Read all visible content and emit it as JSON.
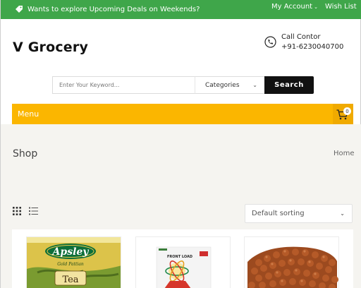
{
  "topbar": {
    "promo_text": "Wants to explore Upcoming Deals on Weekends?",
    "my_account": "My Account",
    "wish_list": "Wish List",
    "bg_color": "#3fa64a"
  },
  "header": {
    "logo": "V Grocery",
    "call_label": "Call Contor",
    "call_number": "+91-6230040700"
  },
  "search": {
    "placeholder": "Enter Your Keyword...",
    "category": "Categories",
    "button": "Search"
  },
  "menubar": {
    "label": "Menu",
    "cart_count": "0",
    "bg_color": "#fbb600"
  },
  "shop": {
    "title": "Shop",
    "breadcrumb": "Home",
    "sort": "Default sorting"
  },
  "products": [
    {
      "brand": "Apsley",
      "subtitle": "Gold Pattian",
      "label": "Tea",
      "icon": "tea-pack-image"
    },
    {
      "title": "FRONT LOAD",
      "icon": "detergent-box-image"
    },
    {
      "icon": "chickpeas-image"
    }
  ]
}
